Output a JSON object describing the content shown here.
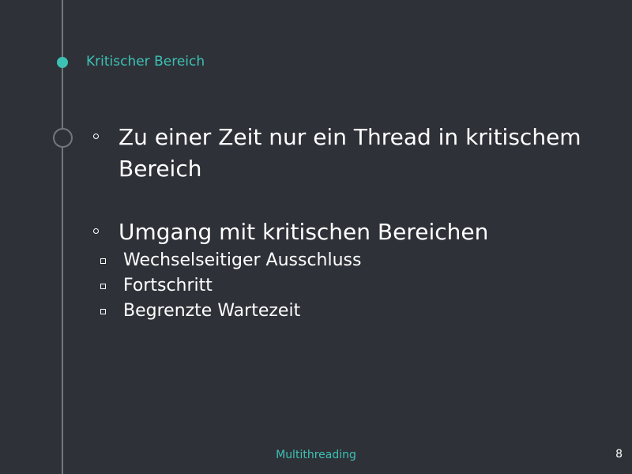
{
  "slide": {
    "section_title": "Kritischer Bereich",
    "footer_title": "Multithreading",
    "page_number": "8",
    "bullets": [
      {
        "text": "Zu einer Zeit nur ein Thread in kritischem Bereich",
        "sub": []
      },
      {
        "text": "Umgang mit kritischen Bereichen",
        "sub": [
          "Wechselseitiger Ausschluss",
          "Fortschritt",
          "Begrenzte Wartezeit"
        ]
      }
    ]
  },
  "colors": {
    "background": "#2f3138",
    "accent": "#3cc1b4",
    "timeline": "#74767c",
    "text": "#ffffff"
  }
}
